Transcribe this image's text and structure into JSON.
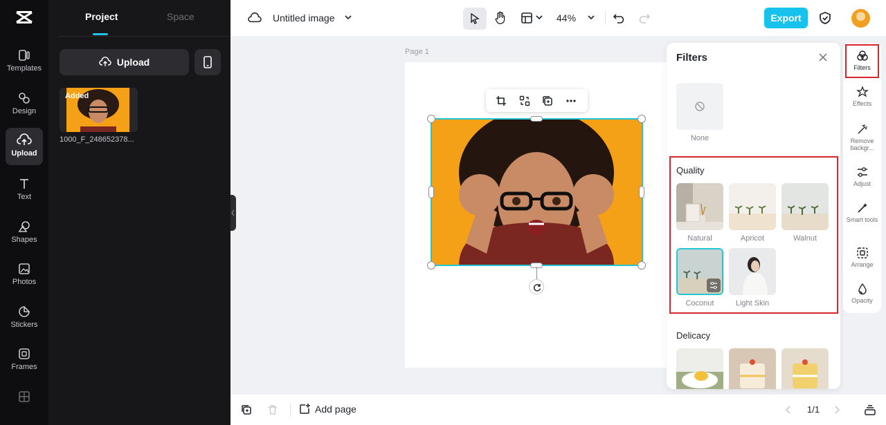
{
  "rail": {
    "items": [
      {
        "label": "Templates",
        "icon": "templates-icon"
      },
      {
        "label": "Design",
        "icon": "design-icon"
      },
      {
        "label": "Upload",
        "icon": "upload-cloud-icon"
      },
      {
        "label": "Text",
        "icon": "text-icon"
      },
      {
        "label": "Shapes",
        "icon": "shapes-icon"
      },
      {
        "label": "Photos",
        "icon": "photos-icon"
      },
      {
        "label": "Stickers",
        "icon": "stickers-icon"
      },
      {
        "label": "Frames",
        "icon": "frames-icon"
      }
    ]
  },
  "panel": {
    "tabs": [
      "Project",
      "Space"
    ],
    "upload_label": "Upload",
    "asset": {
      "badge": "Added",
      "name": "1000_F_248652378..."
    }
  },
  "topbar": {
    "title": "Untitled image",
    "zoom": "44%",
    "export_label": "Export"
  },
  "canvas": {
    "page_label": "Page 1"
  },
  "filters": {
    "title": "Filters",
    "none_label": "None",
    "sections": [
      {
        "title": "Quality",
        "items": [
          "Natural",
          "Apricot",
          "Walnut",
          "Coconut",
          "Light Skin"
        ],
        "selected": "Coconut"
      },
      {
        "title": "Delicacy",
        "items": []
      }
    ]
  },
  "tools": [
    {
      "label": "Filters",
      "icon": "filters-icon"
    },
    {
      "label": "Effects",
      "icon": "effects-icon"
    },
    {
      "label": "Remove backgr...",
      "icon": "remove-background-icon"
    },
    {
      "label": "Adjust",
      "icon": "adjust-icon"
    },
    {
      "label": "Smart tools",
      "icon": "smart-tools-icon"
    },
    {
      "label": "Arrange",
      "icon": "arrange-icon"
    },
    {
      "label": "Opacity",
      "icon": "opacity-icon"
    }
  ],
  "bottombar": {
    "add_page_label": "Add page",
    "page_count": "1/1"
  },
  "colors": {
    "accent": "#17c3ec",
    "highlight": "#d7262e",
    "selection": "#21c5d4"
  }
}
